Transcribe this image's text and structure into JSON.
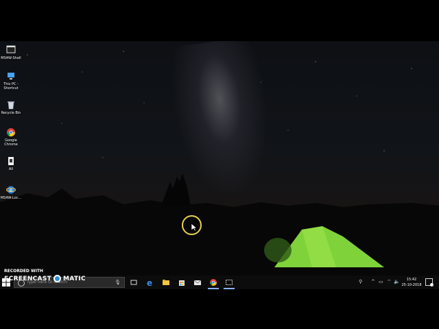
{
  "desktop": {
    "icons": [
      {
        "label": "MS4W-Shell",
        "icon": "terminal-icon"
      },
      {
        "label": "This PC - Shortcut",
        "icon": "computer-icon"
      },
      {
        "label": "Recycle Bin",
        "icon": "recycle-bin-icon"
      },
      {
        "label": "Google Chrome",
        "icon": "chrome-icon"
      },
      {
        "label": "All",
        "icon": "document-icon"
      },
      {
        "label": "MS4W-Loc...",
        "icon": "ie-icon"
      }
    ]
  },
  "taskbar": {
    "search_placeholder": "Type here to search",
    "apps": [
      "task-view-icon",
      "edge-icon",
      "file-explorer-icon",
      "store-icon",
      "mail-icon",
      "chrome-icon",
      "snipping-icon"
    ],
    "clock_time": "15:42",
    "clock_date": "25-10-2018"
  },
  "watermark": {
    "line1": "RECORDED WITH",
    "line2a": "SCREENCAST",
    "line2b": "MATIC"
  },
  "colors": {
    "taskbar": "#0c0c0c",
    "horizon_glow": "#d2611b",
    "tent": "#7fd23a",
    "cursor_ring": "#e6d34a"
  }
}
